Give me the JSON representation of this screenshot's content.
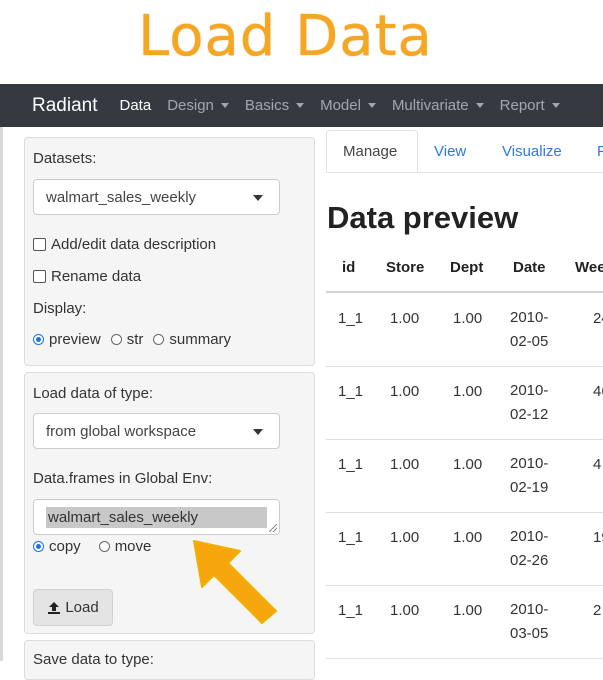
{
  "banner": {
    "title": "Load Data"
  },
  "navbar": {
    "brand": "Radiant",
    "items": [
      {
        "label": "Data",
        "active": true,
        "dropdown": false
      },
      {
        "label": "Design",
        "active": false,
        "dropdown": true
      },
      {
        "label": "Basics",
        "active": false,
        "dropdown": true
      },
      {
        "label": "Model",
        "active": false,
        "dropdown": true
      },
      {
        "label": "Multivariate",
        "active": false,
        "dropdown": true
      },
      {
        "label": "Report",
        "active": false,
        "dropdown": true
      }
    ]
  },
  "sidebar": {
    "datasets_label": "Datasets:",
    "datasets_value": "walmart_sales_weekly",
    "add_edit_desc": "Add/edit data description",
    "rename_data": "Rename data",
    "display_label": "Display:",
    "display_options": [
      "preview",
      "str",
      "summary"
    ],
    "display_selected": "preview",
    "load_type_label": "Load data of type:",
    "load_type_value": "from global workspace",
    "dataframes_label": "Data.frames in Global Env:",
    "dataframes_value": "walmart_sales_weekly",
    "copy_move_options": [
      "copy",
      "move"
    ],
    "copy_move_selected": "copy",
    "load_button": "Load",
    "save_type_label": "Save data to type:"
  },
  "tabs": [
    {
      "label": "Manage",
      "active": true
    },
    {
      "label": "View",
      "active": false
    },
    {
      "label": "Visualize",
      "active": false
    },
    {
      "label": "P",
      "active": false
    }
  ],
  "preview": {
    "heading": "Data preview",
    "columns": [
      "id",
      "Store",
      "Dept",
      "Date",
      "Wee"
    ],
    "rows": [
      {
        "id": "1_1",
        "store": "1.00",
        "dept": "1.00",
        "date": "2010-02-05",
        "weekly": "24"
      },
      {
        "id": "1_1",
        "store": "1.00",
        "dept": "1.00",
        "date": "2010-02-12",
        "weekly": "46"
      },
      {
        "id": "1_1",
        "store": "1.00",
        "dept": "1.00",
        "date": "2010-02-19",
        "weekly": "4"
      },
      {
        "id": "1_1",
        "store": "1.00",
        "dept": "1.00",
        "date": "2010-02-26",
        "weekly": "19"
      },
      {
        "id": "1_1",
        "store": "1.00",
        "dept": "1.00",
        "date": "2010-03-05",
        "weekly": "2"
      }
    ]
  },
  "colors": {
    "accent_orange": "#f5a623",
    "navbar": "#343a40",
    "link_blue": "#2a7ae2",
    "radio_blue": "#1a73e8"
  }
}
